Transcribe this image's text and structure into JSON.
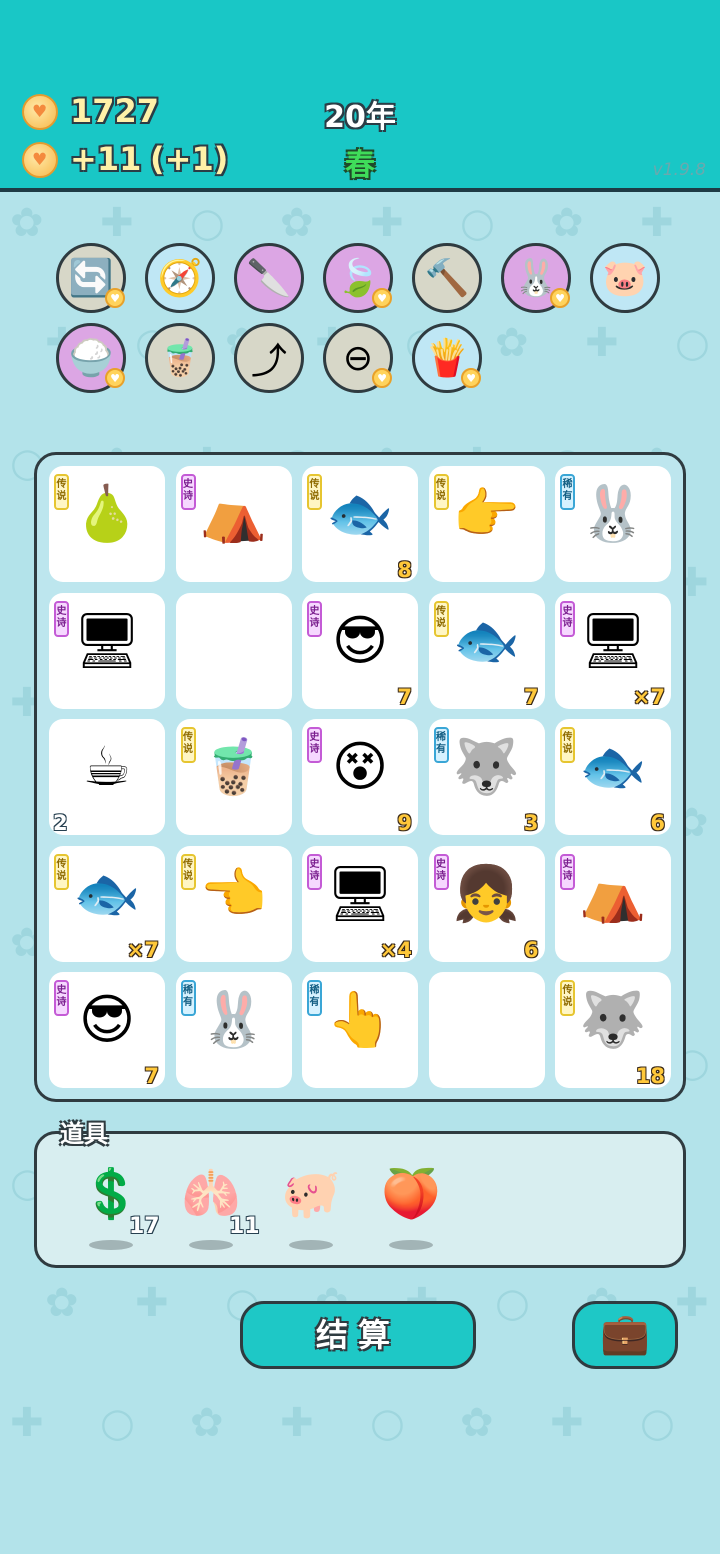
{
  "header": {
    "coins": "1727",
    "income": "+11",
    "income_bonus": "(+1)",
    "year": "20年",
    "season": "春",
    "version": "v1.9.8"
  },
  "skills": [
    {
      "name": "refresh-icon",
      "bg": "#d7d7c8",
      "glyph": "🔄",
      "badge": true
    },
    {
      "name": "compass-icon",
      "bg": "#bfe7f5",
      "glyph": "🧭",
      "badge": false
    },
    {
      "name": "cleaver-icon",
      "bg": "#dca6e4",
      "glyph": "🔪",
      "badge": false
    },
    {
      "name": "leaf-icon",
      "bg": "#dca6e4",
      "glyph": "🍃",
      "badge": true
    },
    {
      "name": "hammer-icon",
      "bg": "#d7d7c8",
      "glyph": "🔨",
      "badge": false
    },
    {
      "name": "rabbit-icon",
      "bg": "#dca6e4",
      "glyph": "🐰",
      "badge": true
    },
    {
      "name": "piggy-bank-icon",
      "bg": "#bfe7f5",
      "glyph": "🐷",
      "badge": false
    },
    {
      "name": "rice-bowl-icon",
      "bg": "#dca6e4",
      "glyph": "🍚",
      "badge": true
    },
    {
      "name": "bubble-tea-icon",
      "bg": "#d7d7c8",
      "glyph": "🧋",
      "badge": false
    },
    {
      "name": "arrow-up-icon",
      "bg": "#d7d7c8",
      "glyph": "⤴",
      "badge": false
    },
    {
      "name": "minus-icon",
      "bg": "#d7d7c8",
      "glyph": "⊖",
      "badge": true
    },
    {
      "name": "fries-icon",
      "bg": "#bfe7f5",
      "glyph": "🍟",
      "badge": true
    }
  ],
  "board": [
    {
      "tag": "传说",
      "rarity": "chuan",
      "glyph": "🍐",
      "name": "longan",
      "count": ""
    },
    {
      "tag": "史诗",
      "rarity": "shi",
      "glyph": "⛺",
      "name": "rabbit-tent",
      "count": ""
    },
    {
      "tag": "传说",
      "rarity": "chuan",
      "glyph": "🐟",
      "name": "koi-fish",
      "count": "8"
    },
    {
      "tag": "传说",
      "rarity": "chuan",
      "glyph": "👉",
      "name": "golden-hand",
      "count": ""
    },
    {
      "tag": "稀有",
      "rarity": "xi",
      "glyph": "🐰",
      "name": "rabbit",
      "count": ""
    },
    {
      "tag": "史诗",
      "rarity": "shi",
      "glyph": "🖥",
      "name": "graphics-card",
      "count": ""
    },
    {
      "tag": "",
      "rarity": "",
      "glyph": "",
      "name": "empty",
      "count": ""
    },
    {
      "tag": "史诗",
      "rarity": "shi",
      "glyph": "😎",
      "name": "green-hat-man",
      "count": "7"
    },
    {
      "tag": "传说",
      "rarity": "chuan",
      "glyph": "🐟",
      "name": "koi-fish",
      "count": "7"
    },
    {
      "tag": "史诗",
      "rarity": "shi",
      "glyph": "🖥",
      "name": "graphics-card",
      "count": "×7"
    },
    {
      "tag": "",
      "rarity": "",
      "glyph": "☕",
      "name": "coffee",
      "count": "2",
      "countLeft": true
    },
    {
      "tag": "传说",
      "rarity": "chuan",
      "glyph": "🧋",
      "name": "milk-tea",
      "count": ""
    },
    {
      "tag": "史诗",
      "rarity": "shi",
      "glyph": "😵",
      "name": "dizzy-face",
      "count": "9"
    },
    {
      "tag": "稀有",
      "rarity": "xi",
      "glyph": "🐺",
      "name": "husky",
      "count": "3"
    },
    {
      "tag": "传说",
      "rarity": "chuan",
      "glyph": "🐟",
      "name": "koi-fish",
      "count": "6"
    },
    {
      "tag": "传说",
      "rarity": "chuan",
      "glyph": "🐟",
      "name": "koi-fish",
      "count": "×7"
    },
    {
      "tag": "传说",
      "rarity": "chuan",
      "glyph": "👈",
      "name": "golden-hand",
      "count": ""
    },
    {
      "tag": "史诗",
      "rarity": "shi",
      "glyph": "🖥",
      "name": "graphics-card",
      "count": "×4"
    },
    {
      "tag": "史诗",
      "rarity": "shi",
      "glyph": "👧",
      "name": "girl",
      "count": "6"
    },
    {
      "tag": "史诗",
      "rarity": "shi",
      "glyph": "⛺",
      "name": "rabbit-tent",
      "count": ""
    },
    {
      "tag": "史诗",
      "rarity": "shi",
      "glyph": "😎",
      "name": "green-hat-man",
      "count": "7"
    },
    {
      "tag": "稀有",
      "rarity": "xi",
      "glyph": "🐰",
      "name": "rabbit",
      "count": ""
    },
    {
      "tag": "稀有",
      "rarity": "xi",
      "glyph": "👆",
      "name": "brown-hand",
      "count": ""
    },
    {
      "tag": "",
      "rarity": "",
      "glyph": "",
      "name": "empty",
      "count": ""
    },
    {
      "tag": "传说",
      "rarity": "chuan",
      "glyph": "🐺",
      "name": "king-husky",
      "count": "18"
    }
  ],
  "items_label": "道具",
  "items": [
    {
      "name": "dollar-coin-icon",
      "glyph": "💲",
      "count": "17"
    },
    {
      "name": "liver-icon",
      "glyph": "🫁",
      "count": "11"
    },
    {
      "name": "piggy-bank-icon",
      "glyph": "🐖",
      "count": ""
    },
    {
      "name": "peach-painting-icon",
      "glyph": "🍑",
      "count": ""
    }
  ],
  "settle_label": "结算",
  "bag_glyph": "💼"
}
